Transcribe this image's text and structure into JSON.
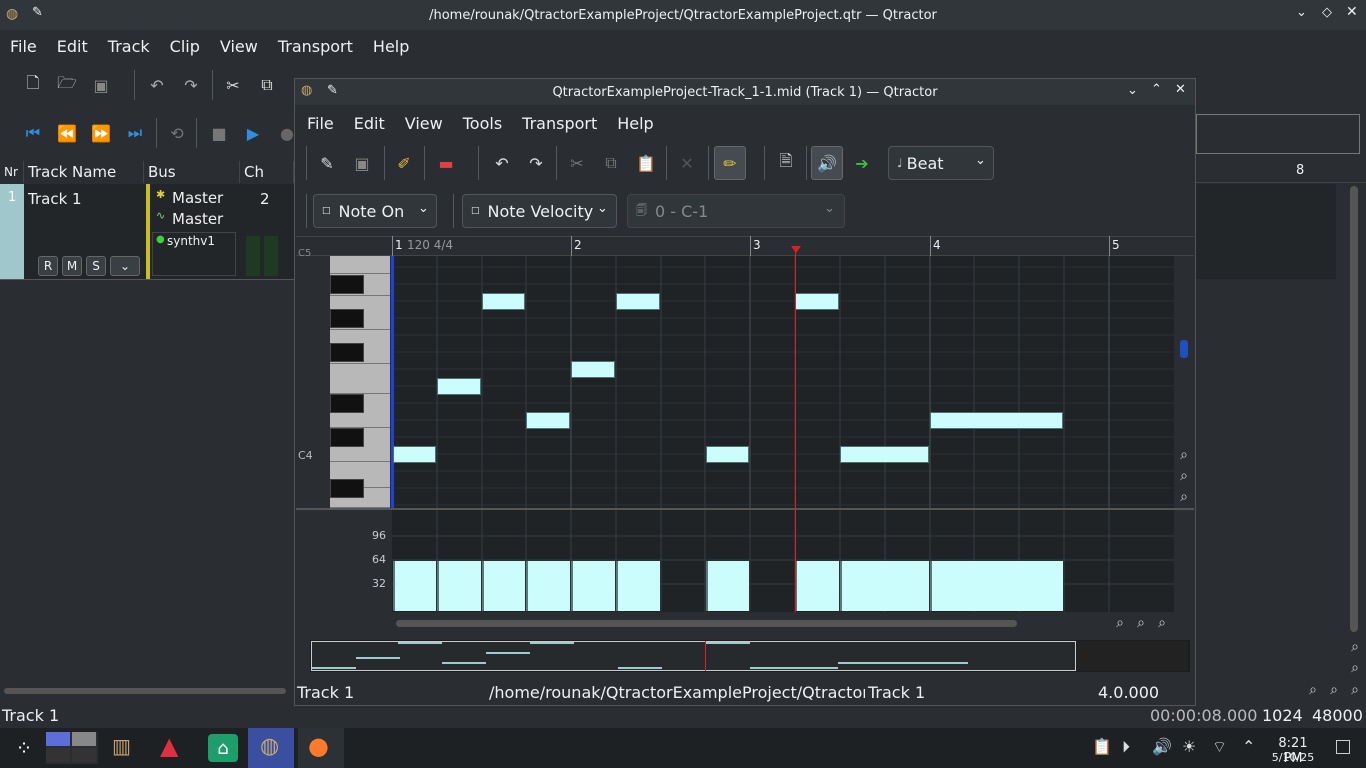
{
  "main_window": {
    "title": "/home/rounak/QtractorExampleProject/QtractorExampleProject.qtr — Qtractor",
    "menu": [
      "File",
      "Edit",
      "Track",
      "Clip",
      "View",
      "Transport",
      "Help"
    ],
    "track_header": {
      "num": "Nr",
      "name": "Track Name",
      "bus": "Bus",
      "ch": "Ch"
    },
    "track": {
      "number": "1",
      "name": "Track 1",
      "bus_in": "Master",
      "bus_out": "Master",
      "plugin": "synthv1",
      "channel": "2",
      "buttons": [
        "R",
        "M",
        "S"
      ]
    },
    "ruler_mark": "8",
    "status_track": "Track 1",
    "status_time": "00:00:08.000",
    "status_buffer": "1024",
    "status_rate": "48000"
  },
  "editor": {
    "title": "QtractorExampleProject-Track_1-1.mid (Track 1) — Qtractor",
    "menu": [
      "File",
      "Edit",
      "View",
      "Tools",
      "Transport",
      "Help"
    ],
    "snap": "Beat",
    "event_type": "Note On",
    "event_param": "Note Velocity",
    "controller": "0 - C-1",
    "ruler": {
      "bar1": "1",
      "tempo": "120 4/4",
      "bar2": "2",
      "bar3": "3",
      "bar4": "4",
      "bar5": "5"
    },
    "c4_label": "C4",
    "c5_label": "C5",
    "velocity_ticks": [
      "96",
      "64",
      "32"
    ],
    "status_track": "Track 1",
    "status_path": "/home/rounak/QtractorExampleProject/QtractorE",
    "status_clip": "Track 1",
    "status_position": "4.0.000",
    "notes": [
      {
        "label": "E4",
        "beat": 0.0,
        "length": 0.5,
        "velocity": 64
      },
      {
        "label": "A4",
        "beat": 0.5,
        "length": 0.5,
        "velocity": 64
      },
      {
        "label": "C5",
        "beat": 1.0,
        "length": 0.5,
        "velocity": 64
      },
      {
        "label": "G4",
        "beat": 1.5,
        "length": 0.5,
        "velocity": 64
      },
      {
        "label": "B4",
        "beat": 2.0,
        "length": 0.5,
        "velocity": 64
      },
      {
        "label": "C5",
        "beat": 2.5,
        "length": 0.5,
        "velocity": 64
      },
      {
        "label": "E4",
        "beat": 3.5,
        "length": 0.5,
        "velocity": 64
      },
      {
        "label": "C5",
        "beat": 4.5,
        "length": 0.5,
        "velocity": 64
      },
      {
        "label": "E4",
        "beat": 5.0,
        "length": 1.0,
        "velocity": 64
      },
      {
        "label": "G4",
        "beat": 6.0,
        "length": 1.5,
        "velocity": 64
      }
    ]
  },
  "taskbar": {
    "clock_time": "8:21 PM",
    "clock_date": "5/10/25"
  }
}
